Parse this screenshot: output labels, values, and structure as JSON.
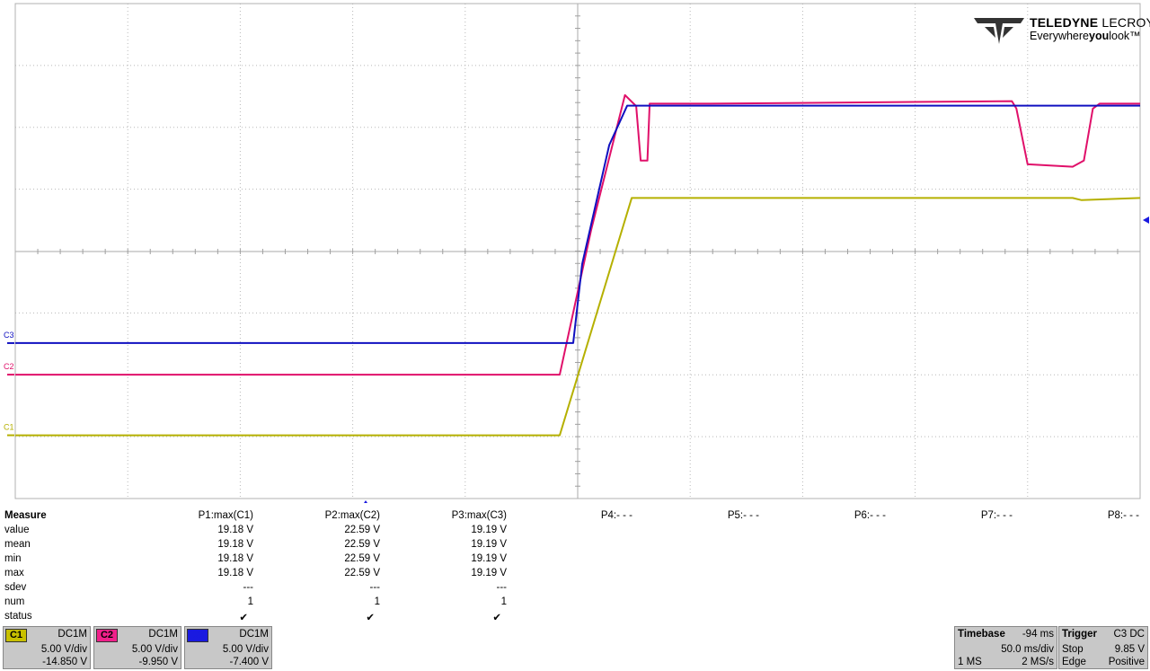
{
  "logo": {
    "brand_bold": "TELEDYNE",
    "brand_light": "LECROY",
    "tagline_a": "Everywhere",
    "tagline_b": "you",
    "tagline_c": "look",
    "tm": "™"
  },
  "channel_markers": [
    {
      "label": "C3",
      "color": "#1010c0"
    },
    {
      "label": "C2",
      "color": "#e0106a"
    },
    {
      "label": "C1",
      "color": "#b5b000"
    }
  ],
  "measure": {
    "title": "Measure",
    "params": [
      "P1:max(C1)",
      "P2:max(C2)",
      "P3:max(C3)",
      "P4:- - -",
      "P5:- - -",
      "P6:- - -",
      "P7:- - -",
      "P8:- - -"
    ],
    "rows": [
      {
        "label": "value",
        "cells": [
          "19.18 V",
          "22.59 V",
          "19.19 V"
        ]
      },
      {
        "label": "mean",
        "cells": [
          "19.18 V",
          "22.59 V",
          "19.19 V"
        ]
      },
      {
        "label": "min",
        "cells": [
          "19.18 V",
          "22.59 V",
          "19.19 V"
        ]
      },
      {
        "label": "max",
        "cells": [
          "19.18 V",
          "22.59 V",
          "19.19 V"
        ]
      },
      {
        "label": "sdev",
        "cells": [
          "---",
          "---",
          "---"
        ]
      },
      {
        "label": "num",
        "cells": [
          "1",
          "1",
          "1"
        ]
      },
      {
        "label": "status",
        "cells": [
          "✔",
          "✔",
          "✔"
        ]
      }
    ]
  },
  "channels": [
    {
      "tag": "C1",
      "color": "#c8c000",
      "coupling": "DC1M",
      "vdiv": "5.00 V/div",
      "offset": "-14.850 V"
    },
    {
      "tag": "C2",
      "color": "#f0208a",
      "coupling": "DC1M",
      "vdiv": "5.00 V/div",
      "offset": "-9.950 V"
    },
    {
      "tag": "C3",
      "color": "#1a1ae0",
      "coupling": "DC1M",
      "vdiv": "5.00 V/div",
      "offset": "-7.400 V"
    }
  ],
  "timebase": {
    "title": "Timebase",
    "delay": "-94 ms",
    "tdiv": "50.0 ms/div",
    "points": "1 MS",
    "rate": "2 MS/s"
  },
  "trigger": {
    "title": "Trigger",
    "source": "C3 DC",
    "mode": "Stop",
    "level": "9.85 V",
    "type": "Edge",
    "slope": "Positive"
  },
  "chart_data": {
    "type": "line",
    "xunit": "ms",
    "x_range": [
      -344,
      156
    ],
    "series": [
      {
        "name": "C1",
        "color": "#b5b000",
        "points": [
          [
            -344,
            0.0
          ],
          [
            -102,
            0.0
          ],
          [
            -70,
            19.18
          ],
          [
            126,
            19.18
          ],
          [
            130,
            19.0
          ],
          [
            156,
            19.18
          ]
        ]
      },
      {
        "name": "C2",
        "color": "#e0106a",
        "points": [
          [
            -344,
            0.0
          ],
          [
            -102,
            0.0
          ],
          [
            -88,
            11.7
          ],
          [
            -73,
            22.59
          ],
          [
            -68,
            21.7
          ],
          [
            -66,
            17.3
          ],
          [
            -63,
            17.3
          ],
          [
            -62,
            21.9
          ],
          [
            -54,
            21.9
          ],
          [
            -35,
            21.9
          ],
          [
            99,
            22.1
          ],
          [
            101,
            21.5
          ],
          [
            106,
            17.0
          ],
          [
            126,
            16.8
          ],
          [
            131,
            17.3
          ],
          [
            135,
            21.5
          ],
          [
            138,
            21.9
          ],
          [
            156,
            21.9
          ]
        ]
      },
      {
        "name": "C3",
        "color": "#1010c0",
        "points": [
          [
            -344,
            0.0
          ],
          [
            -96,
            0.0
          ],
          [
            -92,
            6.4
          ],
          [
            -80,
            16.0
          ],
          [
            -72,
            19.19
          ],
          [
            156,
            19.19
          ]
        ]
      }
    ]
  }
}
